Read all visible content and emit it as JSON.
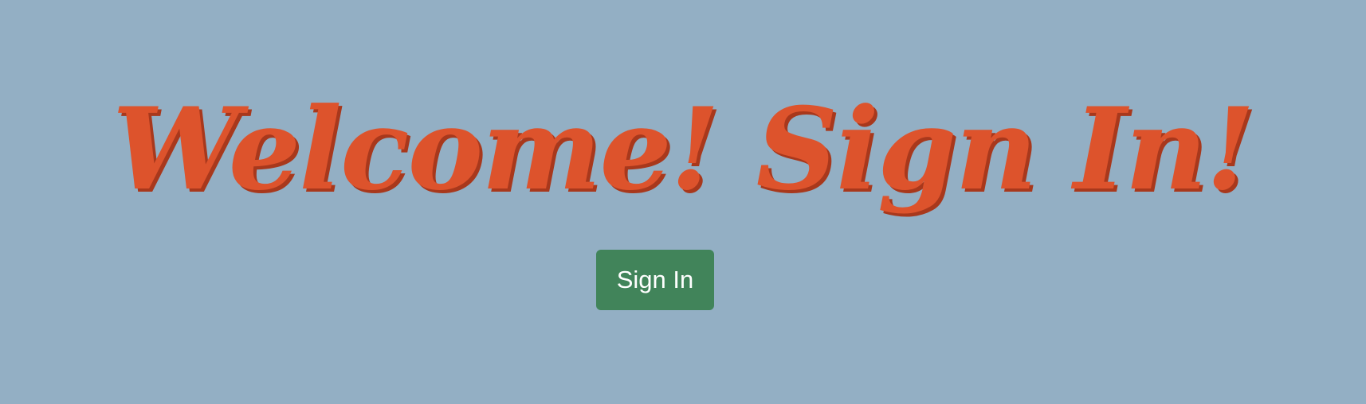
{
  "page": {
    "heading": "Welcome! Sign In!",
    "background_color": "#93afc4",
    "heading_color": "#dd532c",
    "heading_shadow_color": "#a8381c"
  },
  "actions": {
    "sign_in_label": "Sign In",
    "sign_in_color": "#41845a"
  }
}
